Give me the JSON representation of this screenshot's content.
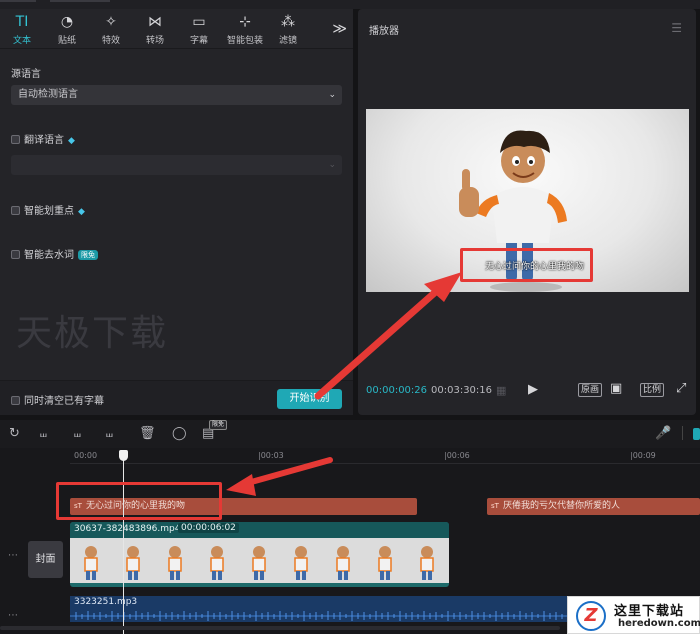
{
  "tool_tabs": [
    {
      "label": "文本",
      "icon": "text-tool-icon",
      "glyph": "TI"
    },
    {
      "label": "贴纸",
      "icon": "sticker-icon",
      "glyph": "◔"
    },
    {
      "label": "特效",
      "icon": "effects-icon",
      "glyph": "✧"
    },
    {
      "label": "转场",
      "icon": "transition-icon",
      "glyph": "⋈"
    },
    {
      "label": "字幕",
      "icon": "caption-icon",
      "glyph": "▭"
    },
    {
      "label": "智能包装",
      "icon": "smart-pack-icon",
      "glyph": "⊹"
    },
    {
      "label": "滤镜",
      "icon": "filter-icon",
      "glyph": "⁂"
    }
  ],
  "tabs_more": "≫",
  "source_language": {
    "label": "源语言",
    "value": "自动检测语言"
  },
  "translate": {
    "label": "翻译语言"
  },
  "highlight": {
    "label": "智能划重点"
  },
  "filler": {
    "label": "智能去水词",
    "badge": "限免"
  },
  "watermark_text": "天极下载",
  "clear_existing": {
    "label": "同时清空已有字幕"
  },
  "start_button": "开始识别",
  "player": {
    "title": "播放器",
    "subtitle": "无心过问你的心里我的吻",
    "current_time": "00:00:00:26",
    "total_time": "00:03:30:16",
    "ctrl_original": "原画",
    "ctrl_ratio": "比例"
  },
  "toolbar": {
    "badge": "限免"
  },
  "timeline": {
    "ruler": [
      "00:00",
      "|00:03",
      "|00:06",
      "|00:09"
    ],
    "cover_label": "封面",
    "subtitle_clips": [
      "无心过问你的心里我的吻",
      "厌倦我的亏欠代替你所爱的人"
    ],
    "video_clip": {
      "name": "30637-382483896.mp4",
      "duration": "00:00:06:02"
    },
    "audio_clip": {
      "name": "3323251.mp3"
    }
  },
  "site_logo": {
    "title": "这里下载站",
    "subtitle": "heredown.com",
    "mark": "Z"
  },
  "colors": {
    "accent": "#1fa8b5",
    "annotation_red": "#e53935",
    "subtitle_clip": "#a84d3c",
    "video_clip": "#1d6a6a",
    "audio_clip": "#1a3a66"
  }
}
